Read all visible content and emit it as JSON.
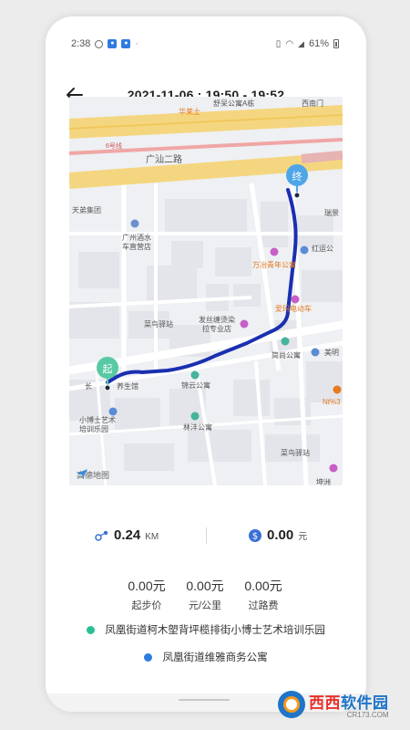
{
  "status_bar": {
    "time": "2:38",
    "battery": "61%"
  },
  "header": {
    "title": "2021-11-06 : 19:50 - 19:52"
  },
  "map": {
    "labels": {
      "hualaishi": "华莱士",
      "shuchenggongyu": "舒呆公寓A栋",
      "ximenkou": "西南门",
      "road_6": "6号线",
      "guangshan_road": "广汕二路",
      "tiandi": "天弟集团",
      "gz_jiushui_line1": "广州酒水",
      "gz_jiushui_line2": "车直营店",
      "wanzhi_line1": "万冶青年公寓",
      "honglian": "红运公",
      "ruijing": "瑞景",
      "aima": "爱玛电动车",
      "cainiao1": "菜鸟驿站",
      "fasi_line1": "发丝缠烫染",
      "fasi_line2": "拉专业店",
      "jianshang": "简尚公寓",
      "meiming": "美明",
      "changyang": "长",
      "yangsheng": "养生馆",
      "jinyun": "锦云公寓",
      "xiaoboshi_line1": "小博士艺术",
      "xiaoboshi_line2": "培训乐园",
      "linfeng": "林沣公寓",
      "cainiao2": "菜鸟驿站",
      "nt3": "Nt%3 Le",
      "bottom_right": "坤洲",
      "start_marker": "起",
      "end_marker": "终",
      "logo": "高德地图"
    }
  },
  "stats": {
    "distance_value": "0.24",
    "distance_unit": "KM",
    "cost_value": "0.00",
    "cost_unit": "元"
  },
  "fees": [
    {
      "amount": "0.00元",
      "label": "起步价"
    },
    {
      "amount": "0.00元",
      "label": "元/公里"
    },
    {
      "amount": "0.00元",
      "label": "过路费"
    }
  ],
  "addresses": {
    "start": "凤凰街道柯木塱背坪榄排街小博士艺术培训乐园",
    "end": "凤凰街道维雅商务公寓"
  },
  "colors": {
    "route": "#1a2fb0",
    "start_dot": "#2bbf95",
    "end_dot": "#2f7be0",
    "start_marker": "#58c9a4",
    "end_marker": "#4ea6e8"
  },
  "watermark": {
    "main_a": "西西",
    "main_b": "软件园",
    "sub": "CR173.COM"
  }
}
